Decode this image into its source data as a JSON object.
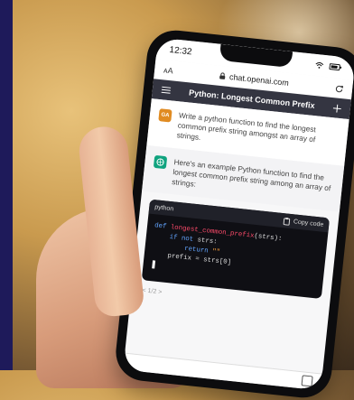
{
  "status": {
    "time": "12:32"
  },
  "browser": {
    "text_size": "ᴀA",
    "url": "chat.openai.com"
  },
  "chat": {
    "title": "Python: Longest Common Prefix"
  },
  "user": {
    "avatar_initials": "GA",
    "prompt": "Write a python function to find the longest common prefix string amongst an array of strings."
  },
  "assistant": {
    "intro": "Here's an example Python function to find the longest common prefix string among an array of strings:"
  },
  "code": {
    "language": "python",
    "copy_label": "Copy code",
    "line1_def": "def",
    "line1_fn": "longest_common_prefix",
    "line1_args": "(strs):",
    "line2_if": "if",
    "line2_not": "not",
    "line2_rest": "strs:",
    "line3_return": "return",
    "line3_str": "\"\"",
    "line4": "prefix = strs[0]"
  },
  "pager": "< 1/2 >"
}
